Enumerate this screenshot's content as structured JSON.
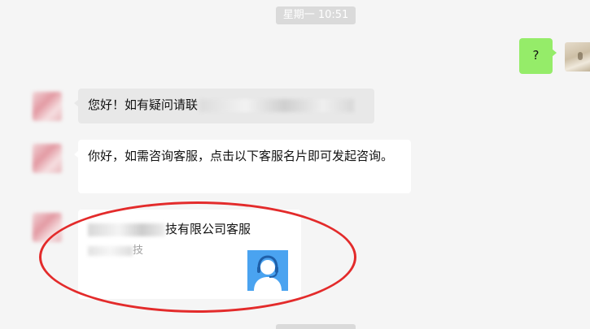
{
  "chat": {
    "timestamp": "星期一 10:51",
    "outgoing": {
      "text": "?"
    },
    "incoming": [
      {
        "text": "您好！如有疑问请联"
      },
      {
        "text": "你好，如需咨询客服，点击以下客服名片即可发起咨询。"
      }
    ],
    "contact_card": {
      "name_suffix": "技有限公司客服",
      "subtitle_suffix": "技"
    }
  },
  "colors": {
    "outgoing_bubble": "#95ec69",
    "annotation": "#e32b2b",
    "card_avatar_bg": "#4aa3f0"
  },
  "icons": {
    "card_avatar": "customer-service-headset-icon"
  }
}
